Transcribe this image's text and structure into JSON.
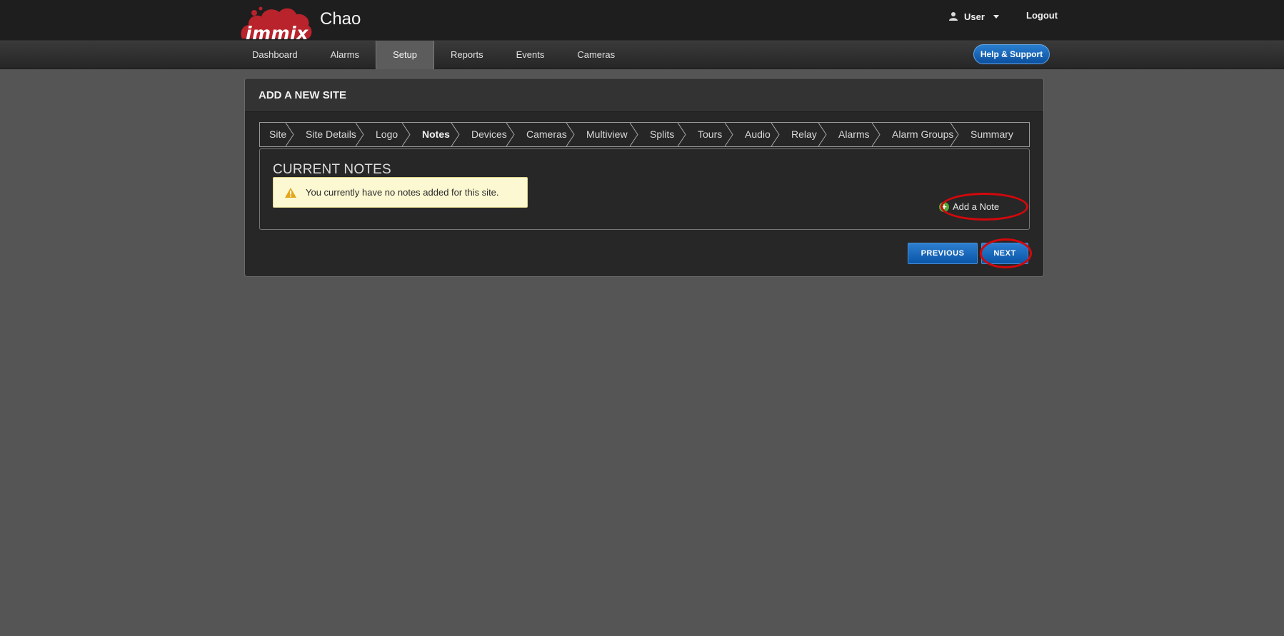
{
  "header": {
    "logo_text": "immix",
    "app_title": "Chao",
    "user_label": "User",
    "logout_label": "Logout"
  },
  "nav": {
    "items": [
      {
        "label": "Dashboard"
      },
      {
        "label": "Alarms"
      },
      {
        "label": "Setup",
        "active": true
      },
      {
        "label": "Reports"
      },
      {
        "label": "Events"
      },
      {
        "label": "Cameras"
      }
    ],
    "help_label": "Help & Support"
  },
  "panel": {
    "title": "ADD A NEW SITE",
    "steps": [
      {
        "label": "Site"
      },
      {
        "label": "Site Details"
      },
      {
        "label": "Logo"
      },
      {
        "label": "Notes",
        "active": true
      },
      {
        "label": "Devices"
      },
      {
        "label": "Cameras"
      },
      {
        "label": "Multiview"
      },
      {
        "label": "Splits"
      },
      {
        "label": "Tours"
      },
      {
        "label": "Audio"
      },
      {
        "label": "Relay"
      },
      {
        "label": "Alarms"
      },
      {
        "label": "Alarm Groups"
      },
      {
        "label": "Summary"
      }
    ],
    "notes_title": "CURRENT NOTES",
    "empty_message": "You currently have no notes added for this site.",
    "add_note_label": "Add a Note",
    "previous_label": "PREVIOUS",
    "next_label": "NEXT"
  },
  "colors": {
    "accent_blue": "#0b5ab0",
    "highlight_ring": "#d3080c",
    "alert_bg": "#fbf8d2",
    "add_icon_green": "#57a533"
  }
}
